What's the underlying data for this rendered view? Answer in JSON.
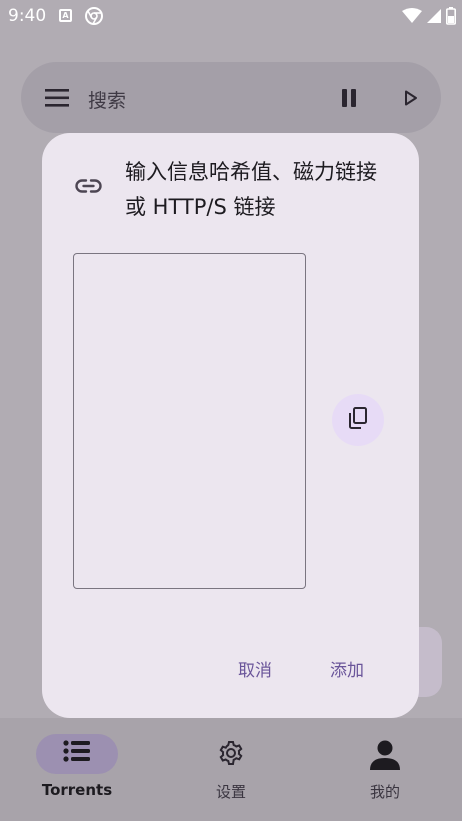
{
  "status_bar": {
    "time": "9:40",
    "notification_letter": "A"
  },
  "search_bar": {
    "placeholder": "搜索"
  },
  "dialog": {
    "title": "输入信息哈希值、磁力链接或 HTTP/S 链接",
    "input_value": "",
    "cancel_label": "取消",
    "confirm_label": "添加"
  },
  "bottom_nav": {
    "items": [
      {
        "label": "Torrents",
        "icon": "list-icon",
        "active": true
      },
      {
        "label": "设置",
        "icon": "gear-icon",
        "active": false
      },
      {
        "label": "我的",
        "icon": "person-icon",
        "active": false
      }
    ]
  },
  "colors": {
    "scrim_background": "#b1acb3",
    "dialog_surface": "#ece6ef",
    "accent_text": "#6a559a",
    "paste_button_fill": "#e7dbf6",
    "nav_active_pill": "#9c90b1"
  }
}
